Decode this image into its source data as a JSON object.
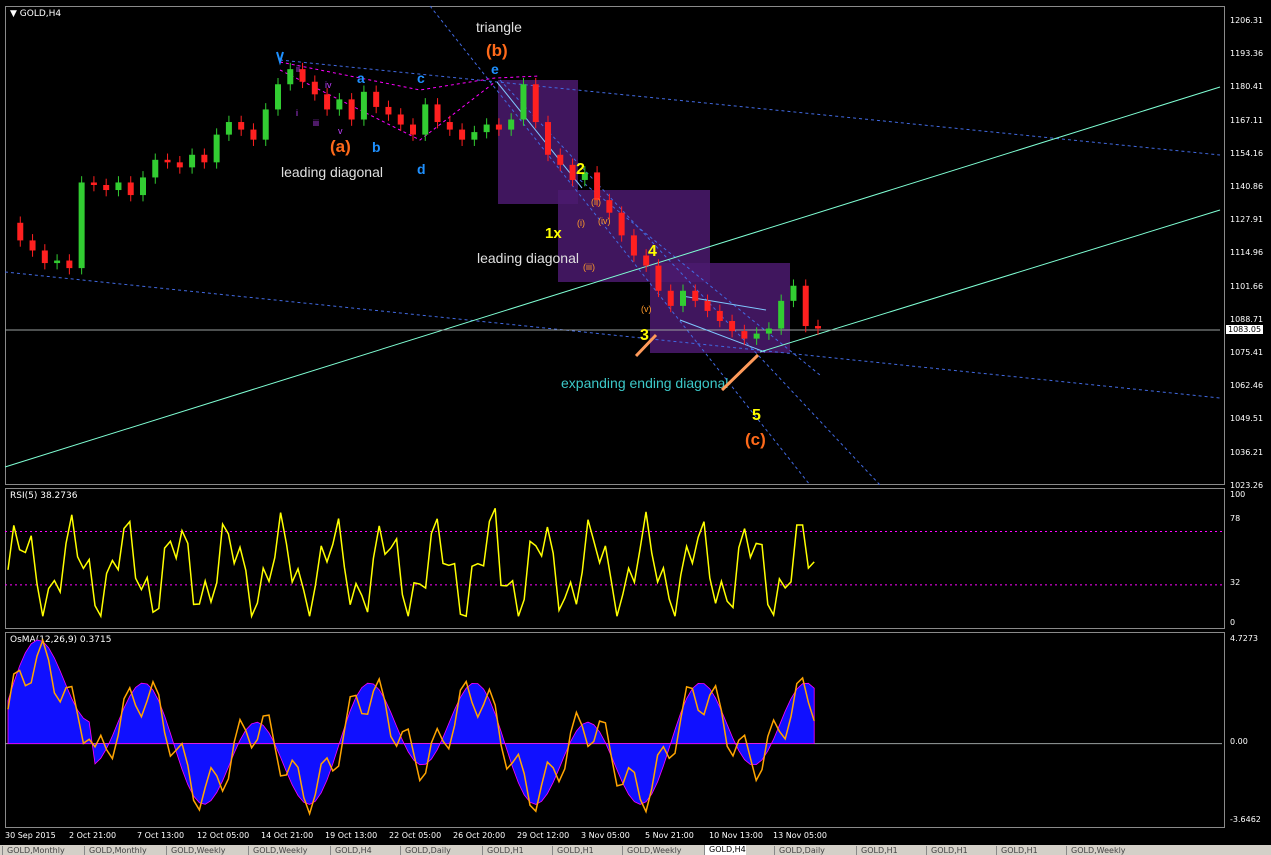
{
  "main_title": "GOLD,H4",
  "rsi_title": "RSI(5) 38.2736",
  "osma_title": "OsMA(12,26,9) 0.3715",
  "current_price": "1083.05",
  "price_ticks": [
    "1206.31",
    "1193.36",
    "1180.41",
    "1167.11",
    "1154.16",
    "1140.86",
    "1127.91",
    "1114.96",
    "1101.66",
    "1088.71",
    "1075.41",
    "1062.46",
    "1049.51",
    "1036.21",
    "1023.26"
  ],
  "rsi_ticks": [
    "100",
    "78",
    "32",
    "0"
  ],
  "osma_ticks": [
    "4.7273",
    "0.00",
    "-3.6462"
  ],
  "time_labels": [
    "30 Sep 2015",
    "2 Oct 21:00",
    "7 Oct 13:00",
    "12 Oct 05:00",
    "14 Oct 21:00",
    "19 Oct 13:00",
    "22 Oct 05:00",
    "26 Oct 20:00",
    "29 Oct 12:00",
    "3 Nov 05:00",
    "5 Nov 21:00",
    "10 Nov 13:00",
    "13 Nov 05:00"
  ],
  "tabs": [
    "GOLD,Monthly",
    "GOLD,Monthly",
    "GOLD,Weekly",
    "GOLD,Weekly",
    "GOLD,H4",
    "GOLD,Daily",
    "GOLD,H1",
    "GOLD,H1",
    "GOLD,Weekly",
    "GOLD,H4",
    "GOLD,Daily",
    "GOLD,H1",
    "GOLD,H1",
    "GOLD,H1",
    "GOLD,Weekly"
  ],
  "active_tab": 9,
  "annotations": {
    "triangle": "triangle",
    "b_paren": "(b)",
    "e_top": "e",
    "a1": "a",
    "c1": "c",
    "a_paren": "(a)",
    "b1": "b",
    "d1": "d",
    "leading_diagonal_1": "leading diagonal",
    "leading_diagonal_2": "leading diagonal",
    "two": "2",
    "one_x": "1x",
    "four": "4",
    "three": "3",
    "five": "5",
    "c_paren": "(c)",
    "expanding": "expanding ending diagonal",
    "ii_small": "ii",
    "iii_small": "iii",
    "iv_small": "iv",
    "v_small": "v",
    "i_small": "i",
    "roman_ii": "(ii)",
    "roman_i": "(i)",
    "roman_iii": "(iii)",
    "roman_iv": "(iv)",
    "roman_v": "(v)"
  },
  "colors": {
    "bull": "#32cd32",
    "bear": "#ff2020",
    "rsi": "#ffff00",
    "osma_line": "#ffa500",
    "osma_fill": "#1010ff",
    "channel": "#4169e1",
    "trend": "#7fffd4",
    "box": "#4b1a6e"
  },
  "chart_data": [
    {
      "type": "candlestick",
      "title": "GOLD,H4",
      "ylim": [
        1023.26,
        1206.31
      ],
      "close_path": [
        1125,
        1118,
        1114,
        1109,
        1110,
        1107,
        1141,
        1140,
        1138,
        1141,
        1136,
        1143,
        1150,
        1149,
        1147,
        1152,
        1149,
        1160,
        1165,
        1162,
        1158,
        1170,
        1180,
        1186,
        1181,
        1176,
        1170,
        1174,
        1166,
        1177,
        1171,
        1168,
        1164,
        1160,
        1172,
        1165,
        1162,
        1158,
        1161,
        1164,
        1162,
        1166,
        1180,
        1165,
        1152,
        1148,
        1142,
        1145,
        1134,
        1129,
        1120,
        1112,
        1108,
        1098,
        1092,
        1098,
        1094,
        1090,
        1086,
        1082,
        1079,
        1081,
        1083,
        1094,
        1100,
        1084,
        1083
      ],
      "current": 1083.05
    },
    {
      "type": "line",
      "title": "RSI(5) 38.2736",
      "ylim": [
        0,
        100
      ],
      "levels": [
        78,
        32
      ],
      "last": 38.2736
    },
    {
      "type": "area",
      "title": "OsMA(12,26,9) 0.3715",
      "ylim": [
        -3.6462,
        4.7273
      ],
      "last": 0.3715
    }
  ]
}
